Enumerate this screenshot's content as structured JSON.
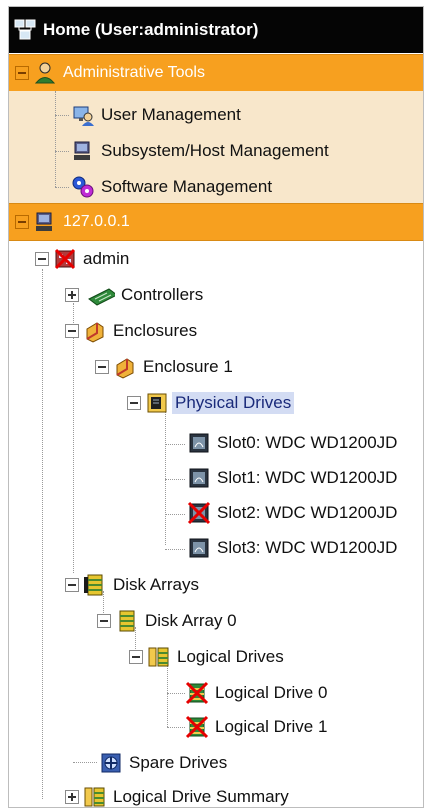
{
  "header": {
    "title": "Home (User:administrator)"
  },
  "admin_tools": {
    "label": "Administrative Tools",
    "items": [
      {
        "label": "User Management"
      },
      {
        "label": "Subsystem/Host Management"
      },
      {
        "label": "Software Management"
      }
    ]
  },
  "host": {
    "label": "127.0.0.1"
  },
  "tree": {
    "admin": "admin",
    "controllers": "Controllers",
    "enclosures": "Enclosures",
    "enclosure_1": "Enclosure 1",
    "physical_drives": "Physical Drives",
    "slots": [
      {
        "label": "Slot0: WDC WD1200JD",
        "status": "ok"
      },
      {
        "label": "Slot1: WDC WD1200JD",
        "status": "ok"
      },
      {
        "label": "Slot2: WDC WD1200JD",
        "status": "error"
      },
      {
        "label": "Slot3: WDC WD1200JD",
        "status": "ok"
      }
    ],
    "disk_arrays": "Disk Arrays",
    "disk_array_0": "Disk Array 0",
    "logical_drives": "Logical Drives",
    "logical_drive_items": [
      {
        "label": "Logical Drive 0",
        "status": "error"
      },
      {
        "label": "Logical Drive 1",
        "status": "error"
      }
    ],
    "spare_drives": "Spare Drives",
    "logical_drive_summary": "Logical Drive Summary"
  },
  "colors": {
    "header_bg": "#050505",
    "group_bar": "#f7a01f",
    "tools_panel": "#f8e7cb",
    "selection": "#d3dcf3"
  }
}
